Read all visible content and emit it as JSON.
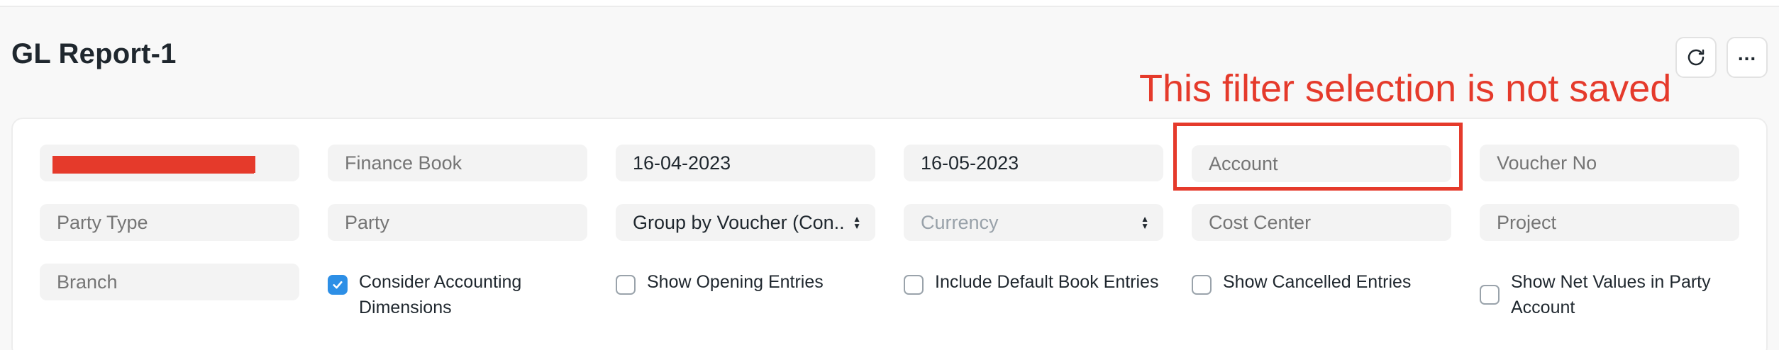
{
  "page": {
    "title": "GL Report-1"
  },
  "actions": {
    "refresh_icon": "refresh-icon",
    "more_label": "..."
  },
  "annotation": {
    "text": "This filter selection is not saved",
    "color": "#e53a2b"
  },
  "filters": {
    "company": {
      "value": "",
      "redacted": true
    },
    "finance_book": {
      "placeholder": "Finance Book"
    },
    "from_date": {
      "value": "16-04-2023"
    },
    "to_date": {
      "value": "16-05-2023"
    },
    "account": {
      "placeholder": "Account"
    },
    "voucher_no": {
      "placeholder": "Voucher No"
    },
    "party_type": {
      "placeholder": "Party Type"
    },
    "party": {
      "placeholder": "Party"
    },
    "group_by": {
      "value": "Group by Voucher (Con..."
    },
    "currency": {
      "placeholder": "Currency"
    },
    "cost_center": {
      "placeholder": "Cost Center"
    },
    "project": {
      "placeholder": "Project"
    },
    "branch": {
      "placeholder": "Branch"
    }
  },
  "checkboxes": {
    "consider_accounting_dimensions": {
      "label_line1": "Consider Accounting",
      "label_line2": "Dimensions",
      "checked": true
    },
    "show_opening_entries": {
      "label": "Show Opening Entries",
      "checked": false
    },
    "include_default_book_entries": {
      "label": "Include Default Book Entries",
      "checked": false
    },
    "show_cancelled_entries": {
      "label": "Show Cancelled Entries",
      "checked": false
    },
    "show_net_values": {
      "label_line1": "Show Net Values in Party",
      "label_line2": "Account",
      "checked": false
    }
  },
  "colors": {
    "accent": "#2d8fe6",
    "field_bg": "#f3f3f3",
    "placeholder": "#98a1a9"
  }
}
